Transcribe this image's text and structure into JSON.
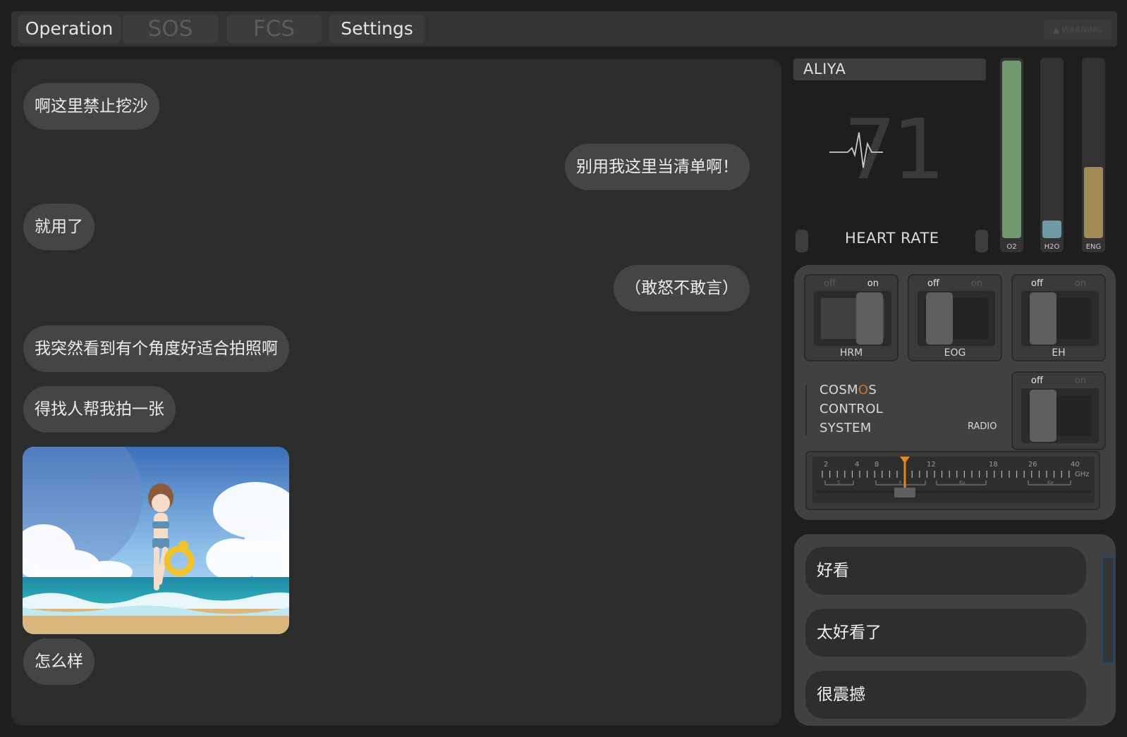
{
  "tabs": {
    "operation": "Operation",
    "sos": "SOS",
    "fcs": "FCS",
    "settings": "Settings",
    "warning": "WARNING"
  },
  "chat": {
    "messages": [
      {
        "side": "left",
        "text": "啊这里禁止挖沙"
      },
      {
        "side": "right",
        "text": "别用我这里当清单啊！"
      },
      {
        "side": "left",
        "text": "就用了"
      },
      {
        "side": "right",
        "text": "（敢怒不敢言）"
      },
      {
        "side": "left",
        "text": "我突然看到有个角度好适合拍照啊"
      },
      {
        "side": "left",
        "text": "得找人帮我拍一张"
      },
      {
        "side": "left",
        "type": "image",
        "alt": "beach-photo"
      },
      {
        "side": "left",
        "text": "怎么样"
      }
    ]
  },
  "status": {
    "name": "ALIYA",
    "heart_rate_value": "71",
    "heart_rate_label": "HEART RATE",
    "gauges": [
      {
        "label": "O2",
        "level": 1.0,
        "color": "#6f9a6f"
      },
      {
        "label": "H2O",
        "level": 0.1,
        "color": "#6e9aa4"
      },
      {
        "label": "ENG",
        "level": 0.4,
        "color": "#a08a55"
      }
    ]
  },
  "controls": {
    "switches": [
      {
        "name": "HRM",
        "off": "off",
        "on": "on",
        "state": "on"
      },
      {
        "name": "EOG",
        "off": "off",
        "on": "on",
        "state": "off"
      },
      {
        "name": "EH",
        "off": "off",
        "on": "on",
        "state": "off"
      },
      {
        "name": "RADIO",
        "off": "off",
        "on": "on",
        "state": "off"
      }
    ],
    "system_title": [
      "COSMOS",
      "CONTROL",
      "SYSTEM"
    ],
    "radio_label": "RADIO",
    "dial": {
      "ticks": [
        "2",
        "4",
        "8",
        "12",
        "18",
        "26",
        "40"
      ],
      "unit": "GHz",
      "bands": [
        "S",
        "X",
        "Ku",
        "Ka"
      ],
      "accent": "#d98a2b"
    }
  },
  "answers": [
    "好看",
    "太好看了",
    "很震撼"
  ]
}
